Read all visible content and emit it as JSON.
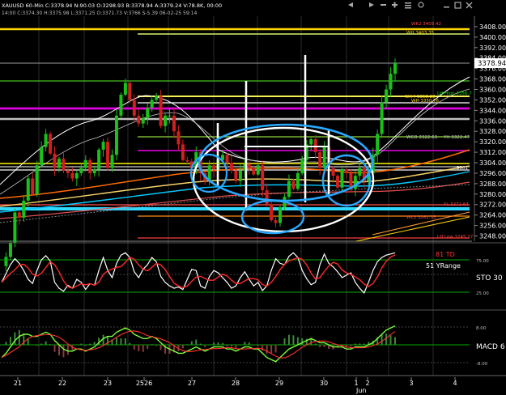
{
  "header": {
    "symbol_line": "XAUUSD 60-Min C:3378.94 N:90.03 O:3298.93 B:3378.94 A:3379.24 V:78.8K, 00:00",
    "ohlc_line": "14:00 C:3374.30 H:3375.98 L:3371.25 O:3371.73 V:3766 S-5.39 06-02-25 59:14"
  },
  "price_panel": {
    "ylim": [
      3244,
      3416
    ],
    "ticks": [
      3408,
      3400,
      3392,
      3384,
      3376,
      3368,
      3360,
      3352,
      3344,
      3336,
      3328,
      3320,
      3312,
      3304,
      3296,
      3288,
      3280,
      3272,
      3264,
      3256,
      3248
    ],
    "tick_labels": [
      "3408.00",
      "3400.00",
      "3392.00",
      "3384.00",
      "3376.00",
      "3368.00",
      "3360.00",
      "3352.00",
      "3344.00",
      "3336.00",
      "3328.00",
      "3320.00",
      "3312.00",
      "3304.00",
      "3296.00",
      "3288.00",
      "3280.00",
      "3272.00",
      "3264.00",
      "3256.00",
      "3248.00"
    ],
    "last_price": "3378.94",
    "colors": {
      "up": "#19c219",
      "down": "#d01f1f"
    }
  },
  "level_labels": [
    {
      "text": "WK2 3409.42",
      "color": "#ff4444"
    },
    {
      "text": "WH 3403.35",
      "color": "#ffd700"
    },
    {
      "text": "LH High 3356.7",
      "color": "#00dd00"
    },
    {
      "text": "WH4 3353.28",
      "color": "#ffd700"
    },
    {
      "text": "WH 3350.76",
      "color": "#ffd700"
    },
    {
      "text": "WCO 3322.63",
      "color": "#cccccc"
    },
    {
      "text": "YH 3322.47",
      "color": "#cccccc"
    },
    {
      "text": "3301",
      "color": "#ffffff"
    },
    {
      "text": "YL 3271.64",
      "color": "#ff4444"
    },
    {
      "text": "WL3 3261.35",
      "color": "#ff4444"
    },
    {
      "text": "LH Low 3245.27",
      "color": "#ff4444"
    }
  ],
  "stoch_panel": {
    "td_label": "81 TD",
    "range_label": "51 YRange",
    "name": "STO 30",
    "tick_labels": [
      "75.00",
      "25.00"
    ]
  },
  "macd_panel": {
    "name": "MACD 6",
    "tick_labels": [
      "8.00",
      "0.00",
      "-8.00"
    ]
  },
  "x_axis": {
    "labels": [
      "21",
      "22",
      "23",
      "2526",
      "27",
      "28",
      "29",
      "30",
      "1",
      "2",
      "3",
      "4"
    ],
    "sub_label": "Jun"
  },
  "chart_data": {
    "type": "candlestick",
    "symbol": "XAUUSD",
    "timeframe": "60-Min",
    "x_labels": [
      "21",
      "22",
      "23",
      "2526",
      "27",
      "28",
      "29",
      "30",
      "1",
      "2",
      "3",
      "4"
    ],
    "ylim": [
      3244,
      3416
    ],
    "last": 3378.94,
    "indicators": [
      "STO 30",
      "MACD 6"
    ],
    "horizontal_levels": [
      3409.42,
      3403.35,
      3356.7,
      3353.28,
      3350.76,
      3322.63,
      3322.47,
      3271.64,
      3261.35,
      3245.27
    ],
    "price_path": [
      3225,
      3232,
      3243,
      3266,
      3262,
      3275,
      3292,
      3280,
      3302,
      3316,
      3326,
      3311,
      3300,
      3307,
      3298,
      3296,
      3292,
      3296,
      3300,
      3306,
      3296,
      3299,
      3314,
      3320,
      3300,
      3310,
      3340,
      3356,
      3365,
      3352,
      3340,
      3334,
      3338,
      3346,
      3352,
      3355,
      3332,
      3340,
      3340,
      3328,
      3318,
      3306,
      3305,
      3300,
      3312,
      3296,
      3290,
      3302,
      3299,
      3306,
      3310,
      3304,
      3298,
      3290,
      3298,
      3303,
      3300,
      3295,
      3302,
      3283,
      3272,
      3260,
      3258,
      3270,
      3278,
      3290,
      3284,
      3296,
      3306,
      3318,
      3322,
      3312,
      3300,
      3316,
      3300,
      3294,
      3285,
      3299,
      3296,
      3284,
      3294,
      3300,
      3290,
      3296,
      3310,
      3326,
      3350,
      3360,
      3372,
      3380
    ],
    "stoch": [
      40,
      55,
      70,
      80,
      72,
      60,
      45,
      38,
      60,
      78,
      85,
      76,
      40,
      30,
      25,
      35,
      30,
      45,
      40,
      28,
      38,
      35,
      60,
      82,
      60,
      48,
      72,
      86,
      90,
      82,
      58,
      48,
      62,
      70,
      82,
      75,
      50,
      40,
      34,
      30,
      32,
      28,
      45,
      62,
      60,
      34,
      30,
      50,
      60,
      56,
      48,
      40,
      30,
      34,
      48,
      58,
      45,
      34,
      40,
      26,
      34,
      60,
      80,
      72,
      70,
      84,
      90,
      82,
      60,
      46,
      36,
      40,
      70,
      88,
      72,
      66,
      58,
      48,
      52,
      56,
      40,
      30,
      22,
      40,
      60,
      75,
      82,
      86,
      88,
      90
    ],
    "macd": [
      -6,
      -4,
      -1,
      2,
      4,
      5,
      5,
      4,
      4,
      5,
      6,
      5,
      2,
      0,
      -2,
      -3,
      -3,
      -2,
      -2,
      -3,
      -2,
      -1,
      1,
      3,
      4,
      4,
      6,
      7,
      8,
      7,
      5,
      4,
      3,
      3,
      4,
      3,
      1,
      -1,
      -2,
      -3,
      -4,
      -4,
      -3,
      -2,
      -1,
      -2,
      -3,
      -2,
      -1,
      -1,
      -1,
      -2,
      -2,
      -3,
      -2,
      -1,
      -1,
      -2,
      -2,
      -4,
      -6,
      -7,
      -8,
      -6,
      -4,
      -2,
      -1,
      0,
      1,
      2,
      3,
      2,
      1,
      1,
      0,
      -1,
      -1,
      -1,
      -2,
      -2,
      -1,
      -1,
      -1,
      0,
      1,
      3,
      5,
      7,
      8,
      9
    ]
  }
}
